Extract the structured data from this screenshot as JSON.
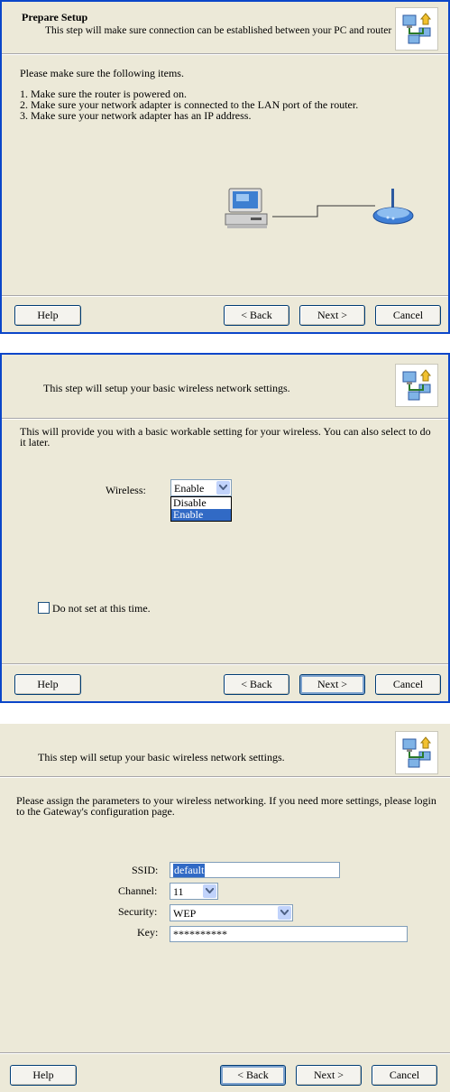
{
  "screen1": {
    "title": "Prepare Setup",
    "subtitle": "This step will make sure connection can be established between your PC and router",
    "intro": "Please make sure the following items.",
    "items": [
      "1. Make sure the router is powered on.",
      "2. Make sure your network adapter is connected to the LAN port of the router.",
      "3. Make sure your network adapter has an IP address."
    ],
    "buttons": {
      "help": "Help",
      "back": "< Back",
      "next": "Next >",
      "cancel": "Cancel"
    }
  },
  "screen2": {
    "subtitle": "This step will setup your basic wireless network settings.",
    "intro": "This will provide you with a basic workable setting for your wireless. You can also select to do it later.",
    "wireless_label": "Wireless:",
    "wireless_value": "Enable",
    "wireless_options": [
      "Disable",
      "Enable"
    ],
    "checkbox_label": "Do not set at this time.",
    "buttons": {
      "help": "Help",
      "back": "< Back",
      "next": "Next >",
      "cancel": "Cancel"
    }
  },
  "screen3": {
    "subtitle": "This step will setup your basic wireless network settings.",
    "intro": "Please assign the parameters to your wireless networking. If you need more settings, please login to the Gateway's configuration page.",
    "ssid_label": "SSID:",
    "ssid_value": "default",
    "channel_label": "Channel:",
    "channel_value": "11",
    "security_label": "Security:",
    "security_value": "WEP",
    "key_label": "Key:",
    "key_value": "**********",
    "buttons": {
      "help": "Help",
      "back": "< Back",
      "next": "Next >",
      "cancel": "Cancel"
    }
  },
  "icons": {
    "header": "network-wizard-icon",
    "pc": "computer-icon",
    "router": "wireless-router-icon"
  },
  "colors": {
    "dialog_bg": "#ece9d8",
    "frame_border": "#0b46c9",
    "selection": "#316ac5"
  }
}
